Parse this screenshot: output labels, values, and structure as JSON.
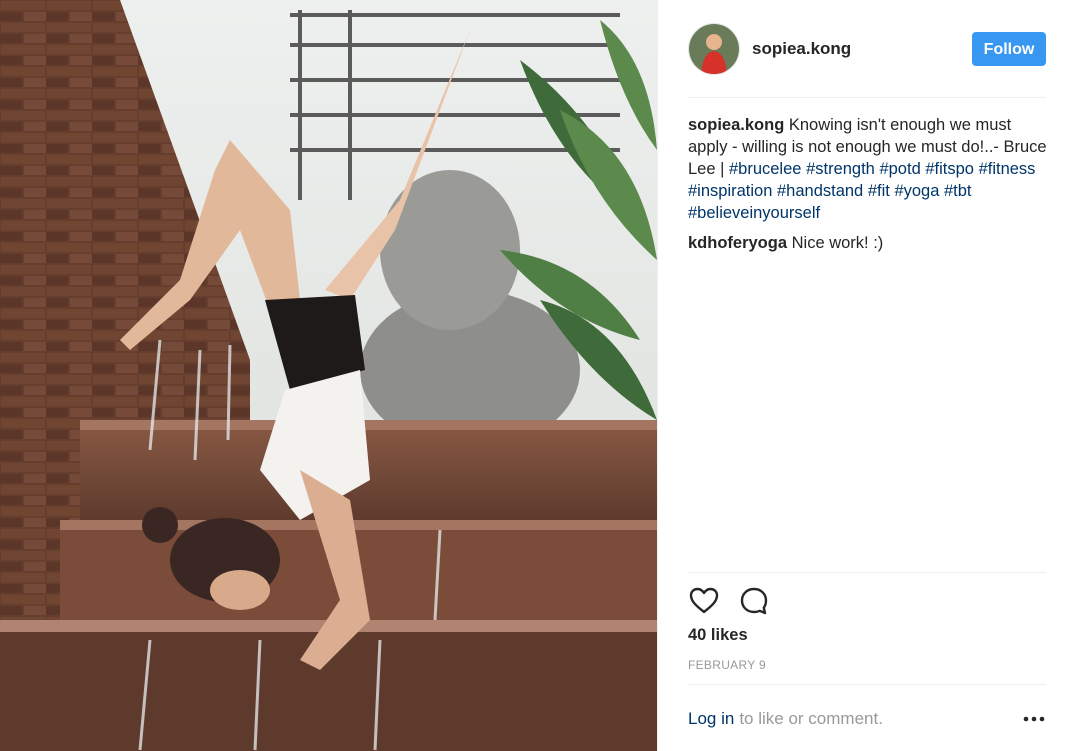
{
  "post": {
    "username": "sopiea.kong",
    "follow_label": "Follow",
    "likes": "40 likes",
    "date": "FEBRUARY 9"
  },
  "caption": {
    "author": "sopiea.kong",
    "text": " Knowing isn't enough we must apply - willing is not enough we must do!..- Bruce Lee | ",
    "hashtags": [
      "#brucelee",
      "#strength",
      "#potd",
      "#fitspo",
      "#fitness",
      "#inspiration",
      "#handstand",
      "#fit",
      "#yoga",
      "#tbt",
      "#believeinyourself"
    ]
  },
  "comments": [
    {
      "author": "kdhoferyoga",
      "text": " Nice work! :)"
    }
  ],
  "footer": {
    "login_label": "Log in",
    "login_suffix": "to like or comment."
  },
  "icons": {
    "like": "heart-icon",
    "comment": "comment-icon",
    "more": "more-options-icon"
  },
  "colors": {
    "follow_bg": "#3897f0",
    "link": "#003569",
    "muted": "#999999"
  }
}
